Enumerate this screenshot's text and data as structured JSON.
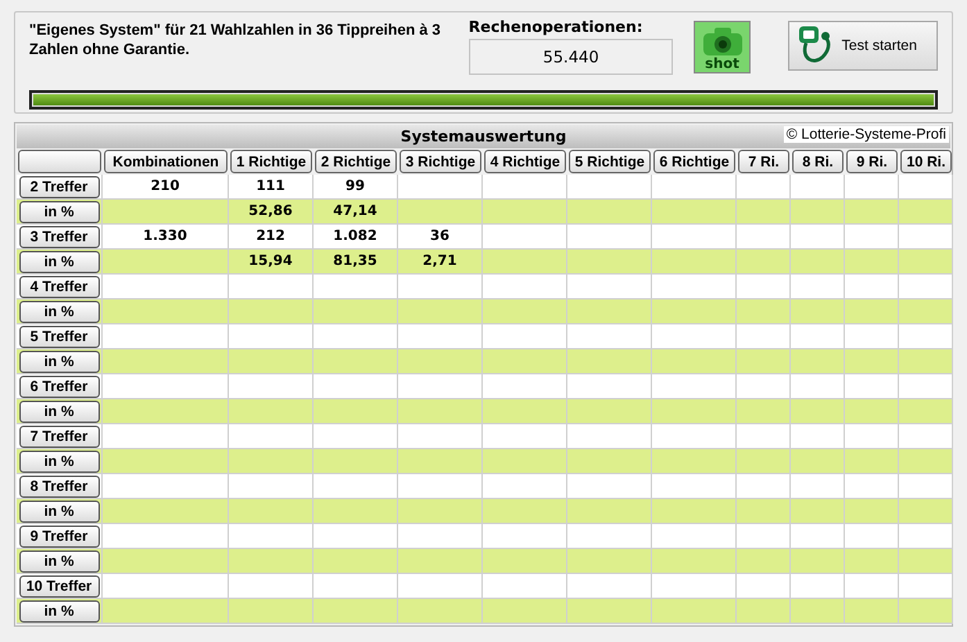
{
  "header": {
    "description": "\"Eigenes System\" für 21 Wahlzahlen in 36 Tippreihen à 3 Zahlen ohne Garantie.",
    "operations_label": "Rechenoperationen:",
    "operations_value": "55.440",
    "shot_button": "shot",
    "test_button": "Test starten"
  },
  "progress": {
    "level": 1
  },
  "table": {
    "title": "Systemauswertung",
    "copyright": "© Lotterie-Systeme-Profi",
    "columns": [
      "Kombinationen",
      "1 Richtige",
      "2 Richtige",
      "3 Richtige",
      "4 Richtige",
      "5 Richtige",
      "6 Richtige",
      "7 Ri.",
      "8 Ri.",
      "9 Ri.",
      "10 Ri."
    ],
    "rows": [
      {
        "label": "2 Treffer",
        "kind": "count",
        "values": [
          "210",
          "111",
          "99"
        ]
      },
      {
        "label": "in %",
        "kind": "percent",
        "values": [
          "52,86",
          "47,14"
        ]
      },
      {
        "label": "3 Treffer",
        "kind": "count",
        "values": [
          "1.330",
          "212",
          "1.082",
          "36"
        ]
      },
      {
        "label": "in %",
        "kind": "percent",
        "values": [
          "15,94",
          "81,35",
          "2,71"
        ]
      },
      {
        "label": "4 Treffer",
        "kind": "count",
        "values": []
      },
      {
        "label": "in %",
        "kind": "percent",
        "values": []
      },
      {
        "label": "5 Treffer",
        "kind": "count",
        "values": []
      },
      {
        "label": "in %",
        "kind": "percent",
        "values": []
      },
      {
        "label": "6 Treffer",
        "kind": "count",
        "values": []
      },
      {
        "label": "in %",
        "kind": "percent",
        "values": []
      },
      {
        "label": "7 Treffer",
        "kind": "count",
        "values": []
      },
      {
        "label": "in %",
        "kind": "percent",
        "values": []
      },
      {
        "label": "8 Treffer",
        "kind": "count",
        "values": []
      },
      {
        "label": "in %",
        "kind": "percent",
        "values": []
      },
      {
        "label": "9 Treffer",
        "kind": "count",
        "values": []
      },
      {
        "label": "in %",
        "kind": "percent",
        "values": []
      },
      {
        "label": "10 Treffer",
        "kind": "count",
        "values": []
      },
      {
        "label": "in %",
        "kind": "percent",
        "values": []
      }
    ]
  }
}
